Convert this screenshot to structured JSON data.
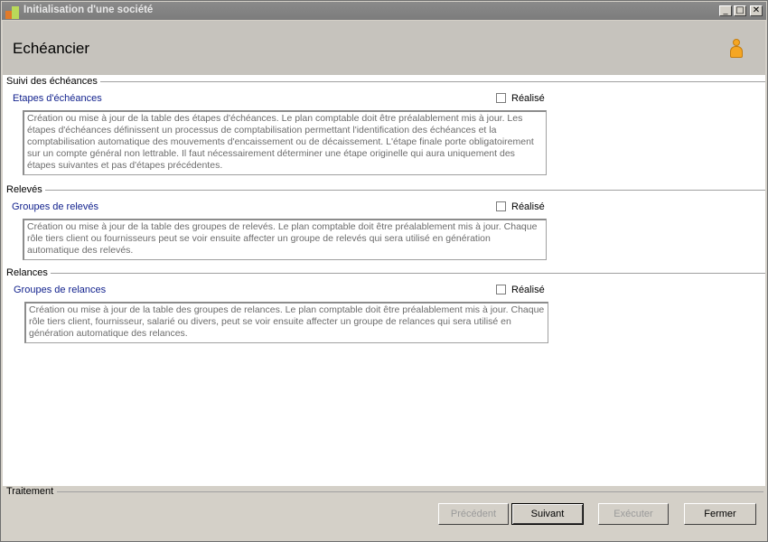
{
  "window": {
    "title": "Initialisation d'une société",
    "controls": {
      "minimize": "_",
      "maximize": "□",
      "close": "✕"
    }
  },
  "header": {
    "title": "Echéancier",
    "icon": "user-icon"
  },
  "sections": [
    {
      "title": "Suivi des échéances",
      "item_label": "Etapes d'échéances",
      "checkbox_label": "Réalisé",
      "checked": false,
      "description": "Création ou mise à jour de la table des étapes d'échéances. Le plan comptable doit être préalablement mis à jour. Les étapes d'échéances définissent un processus de comptabilisation permettant l'identification des échéances et la comptabilisation automatique des mouvements d'encaissement ou de décaissement. L'étape finale porte obligatoirement sur un compte général non lettrable. Il faut nécessairement déterminer une étape originelle qui aura uniquement des étapes suivantes et pas d'étapes précédentes."
    },
    {
      "title": "Relevés",
      "item_label": "Groupes de relevés",
      "checkbox_label": "Réalisé",
      "checked": false,
      "description": "Création ou mise à jour de la table des groupes de relevés. Le plan comptable doit être préalablement mis à jour. Chaque rôle tiers client ou fournisseurs peut se voir ensuite affecter un groupe de relevés qui sera utilisé en génération automatique des relevés."
    },
    {
      "title": "Relances",
      "item_label": "Groupes de relances",
      "checkbox_label": "Réalisé",
      "checked": false,
      "description": "Création ou mise à jour de la table des groupes de relances. Le plan comptable doit être préalablement mis à jour. Chaque rôle tiers client, fournisseur, salarié ou divers, peut se voir ensuite affecter un groupe de relances qui sera utilisé en génération automatique des relances."
    }
  ],
  "footer": {
    "title": "Traitement",
    "buttons": {
      "previous": "Précédent",
      "next": "Suivant",
      "execute": "Exécuter",
      "close": "Fermer"
    }
  }
}
